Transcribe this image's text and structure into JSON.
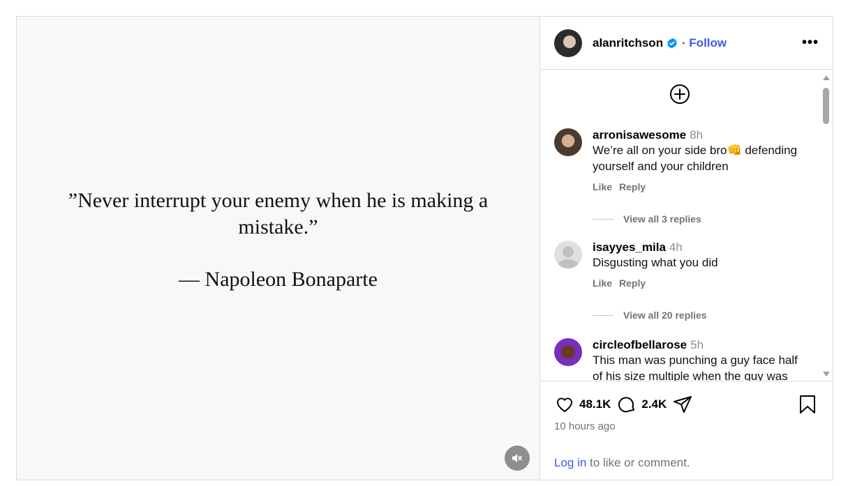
{
  "media": {
    "quote_text": "”Never interrupt your enemy when he is making a mistake.”",
    "quote_author": "— Napoleon Bonaparte",
    "mute_icon": "speaker-muted-icon"
  },
  "header": {
    "username": "alanritchson",
    "separator": "•",
    "follow_label": "Follow",
    "more_label": "•••"
  },
  "comments": [
    {
      "user": "arronisawesome",
      "time": "8h",
      "text": "We’re all on your side bro👊 defending yourself and your children",
      "like_label": "Like",
      "reply_label": "Reply",
      "view_replies": "View all 3 replies"
    },
    {
      "user": "isayyes_mila",
      "time": "4h",
      "text": "Disgusting what you did",
      "like_label": "Like",
      "reply_label": "Reply",
      "view_replies": "View all 20 replies"
    },
    {
      "user": "circleofbellarose",
      "time": "5h",
      "text": "This man was punching a guy face half of his size multiple when the guy was"
    }
  ],
  "footer": {
    "likes": "48.1K",
    "comments_count": "2.4K",
    "time_ago": "10 hours ago",
    "login_link": "Log in",
    "login_suffix": " to like or comment."
  },
  "colors": {
    "accent": "#3f58e9",
    "verified": "#0095f6",
    "muted_text": "#737373"
  }
}
